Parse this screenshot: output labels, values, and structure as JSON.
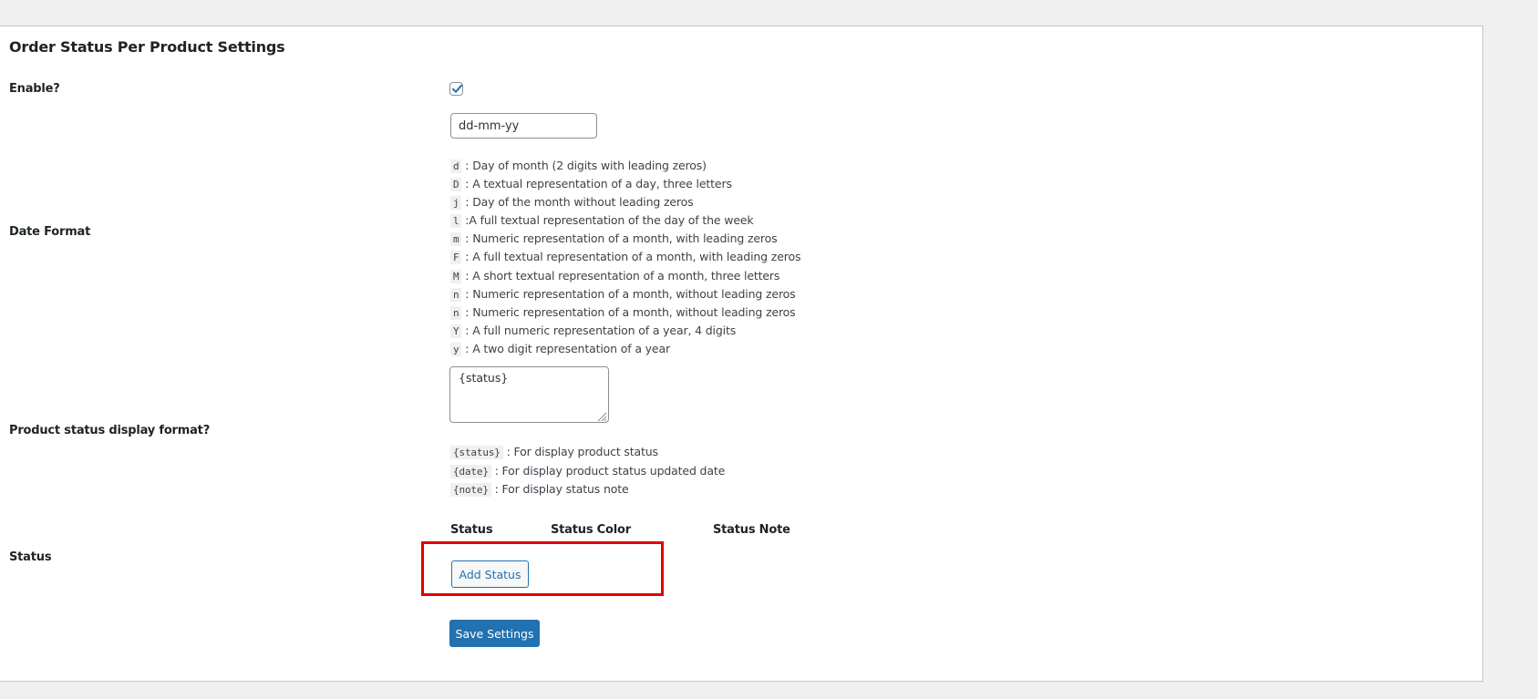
{
  "page": {
    "title": "Order Status Per Product Settings"
  },
  "fields": {
    "enable": {
      "label": "Enable?",
      "checked": true
    },
    "date_format": {
      "label": "Date Format",
      "value": "dd-mm-yy",
      "legend": [
        {
          "code": "d",
          "text": " : Day of month (2 digits with leading zeros)"
        },
        {
          "code": "D",
          "text": " : A textual representation of a day, three letters"
        },
        {
          "code": "j",
          "text": " : Day of the month without leading zeros"
        },
        {
          "code": "l",
          "text": " :A full textual representation of the day of the week"
        },
        {
          "code": "m",
          "text": " : Numeric representation of a month, with leading zeros"
        },
        {
          "code": "F",
          "text": " : A full textual representation of a month, with leading zeros"
        },
        {
          "code": "M",
          "text": " : A short textual representation of a month, three letters"
        },
        {
          "code": "n",
          "text": " : Numeric representation of a month, without leading zeros"
        },
        {
          "code": "n",
          "text": " : Numeric representation of a month, without leading zeros"
        },
        {
          "code": "Y",
          "text": " : A full numeric representation of a year, 4 digits"
        },
        {
          "code": "y",
          "text": " : A two digit representation of a year"
        }
      ]
    },
    "display_format": {
      "label": "Product status display format?",
      "value": "{status}",
      "legend": [
        {
          "code": "{status}",
          "text": " : For display product status"
        },
        {
          "code": "{date}",
          "text": " : For display product status updated date"
        },
        {
          "code": "{note}",
          "text": " : For display status note"
        }
      ]
    },
    "status": {
      "label": "Status",
      "columns": [
        "Status",
        "Status Color",
        "Status Note"
      ],
      "add_button": "Add Status"
    }
  },
  "actions": {
    "save_label": "Save Settings"
  },
  "colors": {
    "accent": "#2271b1",
    "highlight": "#e00000",
    "background": "#f0f0f1"
  }
}
